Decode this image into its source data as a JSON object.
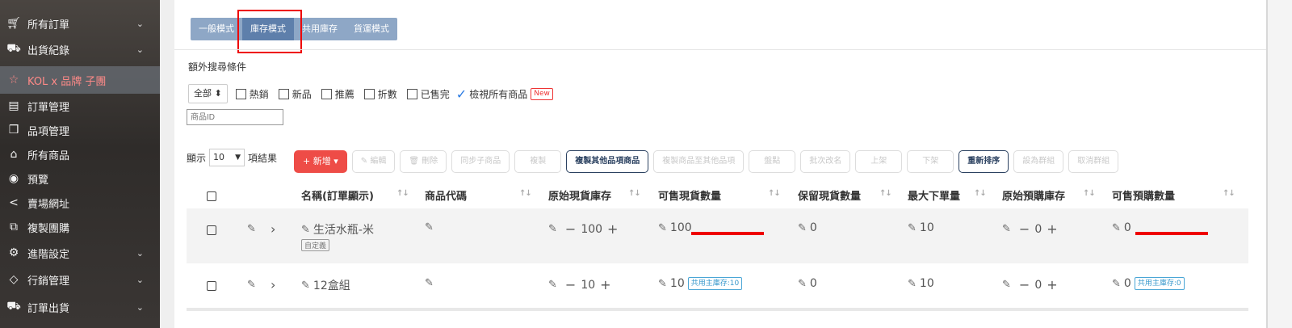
{
  "sidebar": {
    "items": [
      {
        "label": "所有訂單",
        "icon": "cart-icon"
      },
      {
        "label": "出貨紀錄",
        "icon": "truck-icon"
      },
      {
        "label": "KOL x 品牌 子團",
        "icon": "star-icon"
      },
      {
        "label": "訂單管理",
        "icon": "clipboard-icon"
      },
      {
        "label": "品項管理",
        "icon": "box-icon"
      },
      {
        "label": "所有商品",
        "icon": "bag-icon"
      },
      {
        "label": "預覽",
        "icon": "eye-icon"
      },
      {
        "label": "賣場網址",
        "icon": "share-icon"
      },
      {
        "label": "複製團購",
        "icon": "copy-icon"
      },
      {
        "label": "進階設定",
        "icon": "gear-icon"
      },
      {
        "label": "行銷管理",
        "icon": "tag-icon"
      },
      {
        "label": "訂單出貨",
        "icon": "truck-icon"
      }
    ]
  },
  "tabs": [
    "一般模式",
    "庫存模式",
    "共用庫存",
    "貨運模式"
  ],
  "extra_search_label": "額外搜尋條件",
  "filter": {
    "select_value": "全部",
    "options": [
      "熱銷",
      "新品",
      "推薦",
      "折數",
      "已售完"
    ],
    "view_all": "檢視所有商品",
    "new_badge": "New",
    "id_placeholder": "商品ID"
  },
  "pagination": {
    "show_label": "顯示",
    "per_page": "10",
    "suffix": "項結果"
  },
  "toolbar": {
    "add": "+ 新增",
    "edit": "編輯",
    "delete": "刪除",
    "sync_child": "同步子商品",
    "copy": "複製",
    "copy_other_items": "複製其他品項商品",
    "copy_to_other": "複製商品至其他品項",
    "inventory": "盤點",
    "batch_rename": "批次改名",
    "list": "上架",
    "unlist": "下架",
    "resort": "重新排序",
    "set_group": "設為群組",
    "cancel_group": "取消群組"
  },
  "table": {
    "headers": [
      "名稱(訂單顯示)",
      "商品代碼",
      "原始現貨庫存",
      "可售現貨數量",
      "保留現貨數量",
      "最大下單量",
      "原始預購庫存",
      "可售預購數量"
    ],
    "rows": [
      {
        "name": "生活水瓶-米",
        "tag": "自定義",
        "stock": "100",
        "sellable": "100",
        "reserved": "0",
        "max": "10",
        "preorder": "0",
        "sellable_pre": "0"
      },
      {
        "name": "12盒組",
        "stock": "10",
        "sellable": "10",
        "sellable_share": "共用主庫存:10",
        "reserved": "0",
        "max": "10",
        "preorder": "0",
        "sellable_pre": "0",
        "sellable_pre_share": "共用主庫存:0"
      }
    ]
  },
  "colors": {
    "accent_red": "#ee4c47",
    "tab_blue": "#8ea7c6",
    "tab_active": "#5e7fab",
    "navy": "#2c4261"
  }
}
